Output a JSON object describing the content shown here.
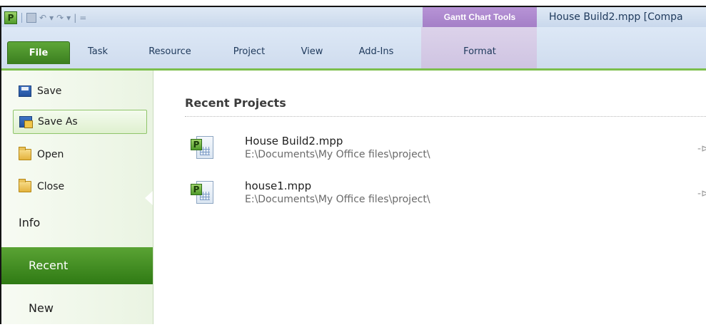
{
  "app": {
    "logo_letter": "P",
    "window_title": "House Build2.mpp [Compa",
    "contextual_group": "Gantt Chart Tools"
  },
  "qat": {
    "undo": "↶",
    "redo": "↷",
    "dropdown": "▾",
    "customize": "=",
    "separator": "|"
  },
  "ribbon": {
    "tabs": {
      "file": "File",
      "task": "Task",
      "resource": "Resource",
      "project": "Project",
      "view": "View",
      "addins": "Add-Ins",
      "format": "Format"
    }
  },
  "backstage": {
    "commands": {
      "save": "Save",
      "save_as": "Save As",
      "open": "Open",
      "close": "Close"
    },
    "sections": {
      "info": "Info",
      "recent": "Recent",
      "new": "New"
    },
    "recent": {
      "title": "Recent Projects",
      "items": [
        {
          "name": "House Build2.mpp",
          "path": "E:\\Documents\\My Office files\\project\\",
          "icon_letter": "P"
        },
        {
          "name": "house1.mpp",
          "path": "E:\\Documents\\My Office files\\project\\",
          "icon_letter": "P"
        }
      ],
      "pin_glyph": "-⊳"
    }
  },
  "colors": {
    "file_tab": "#4a9a2a",
    "selected_section": "#3f8b1e",
    "contextual_tab": "#ac89cd",
    "ribbon_bg": "#d6e2f2"
  }
}
